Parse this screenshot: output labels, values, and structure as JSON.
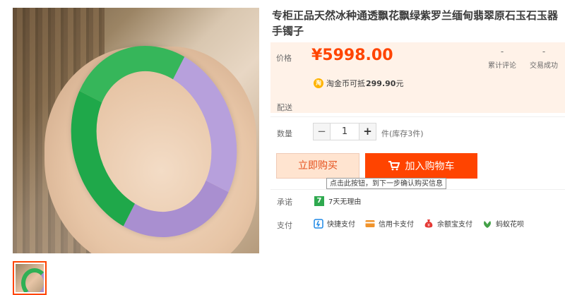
{
  "product": {
    "title": "专柜正品天然冰种通透飘花飘绿紫罗兰缅甸翡翠原石玉石玉器手镯子"
  },
  "price": {
    "label": "价格",
    "value": "¥5998.00"
  },
  "stats": [
    {
      "value": "-",
      "label": "累计评论"
    },
    {
      "value": "-",
      "label": "交易成功"
    }
  ],
  "coin": {
    "icon_text": "淘",
    "text": "淘金币可抵",
    "amount": "299.90",
    "unit": "元"
  },
  "shipping": {
    "label": "配送"
  },
  "quantity": {
    "label": "数量",
    "minus": "−",
    "value": "1",
    "plus": "+",
    "stock": "件(库存3件)"
  },
  "actions": {
    "buy_now": "立即购买",
    "add_to_cart": "加入购物车",
    "tooltip": "点击此按钮，到下一步确认购买信息"
  },
  "promise": {
    "label": "承诺",
    "icon_text": "7",
    "text": "7天无理由"
  },
  "payment": {
    "label": "支付",
    "methods": [
      {
        "label": "快捷支付",
        "icon": "quick-pay-icon",
        "color": "#1e88e5"
      },
      {
        "label": "信用卡支付",
        "icon": "credit-card-icon",
        "color": "#f0932b"
      },
      {
        "label": "余额宝支付",
        "icon": "money-bag-icon",
        "color": "#e53935"
      },
      {
        "label": "蚂蚁花呗",
        "icon": "huabei-icon",
        "color": "#43a047"
      }
    ]
  },
  "colors": {
    "accent": "#ff4400",
    "price": "#ff4400",
    "price_bg": "#fff2e8",
    "buy_bg": "#ffe4d0"
  }
}
